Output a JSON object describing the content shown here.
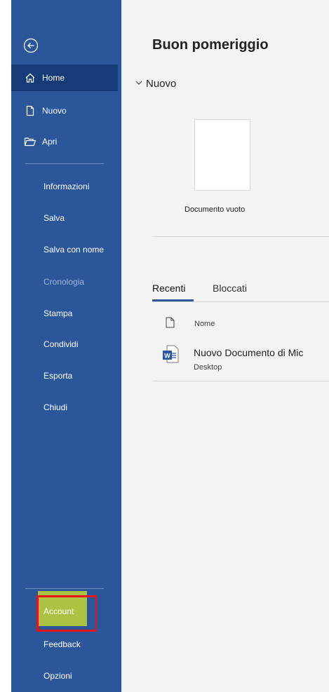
{
  "colors": {
    "sidebar_bg": "#2b579a",
    "active_bg": "#153c78",
    "highlight_yellow": "#d7e628",
    "highlight_red": "#e51515"
  },
  "sidebar": {
    "back_icon": "back-arrow-icon",
    "primary": [
      {
        "id": "home",
        "label": "Home",
        "icon": "home-icon",
        "active": true
      },
      {
        "id": "nuovo",
        "label": "Nuovo",
        "icon": "new-document-icon"
      },
      {
        "id": "apri",
        "label": "Apri",
        "icon": "open-folder-icon"
      }
    ],
    "secondary": [
      {
        "id": "informazioni",
        "label": "Informazioni"
      },
      {
        "id": "salva",
        "label": "Salva"
      },
      {
        "id": "salva-con-nome",
        "label": "Salva con nome"
      },
      {
        "id": "cronologia",
        "label": "Cronologia",
        "dimmed": true
      },
      {
        "id": "stampa",
        "label": "Stampa"
      },
      {
        "id": "condividi",
        "label": "Condividi"
      },
      {
        "id": "esporta",
        "label": "Esporta"
      },
      {
        "id": "chiudi",
        "label": "Chiudi"
      }
    ],
    "bottom": [
      {
        "id": "account",
        "label": "Account",
        "highlighted": true
      },
      {
        "id": "feedback",
        "label": "Feedback"
      },
      {
        "id": "opzioni",
        "label": "Opzioni"
      }
    ]
  },
  "main": {
    "greeting": "Buon pomeriggio",
    "new_section": {
      "label": "Nuovo",
      "templates": [
        {
          "label": "Documento vuoto"
        }
      ]
    },
    "tabs": [
      {
        "label": "Recenti",
        "active": true
      },
      {
        "label": "Bloccati"
      }
    ],
    "table": {
      "column_name": "Nome"
    },
    "files": [
      {
        "name": "Nuovo Documento di Mic",
        "location": "Desktop",
        "icon": "word-file-icon"
      }
    ]
  }
}
